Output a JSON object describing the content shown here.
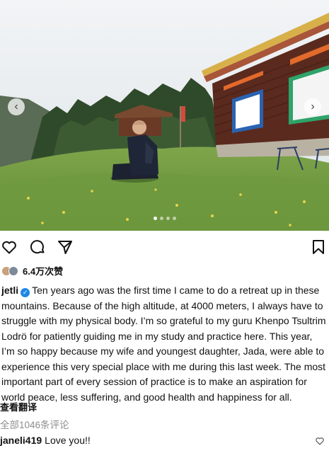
{
  "post": {
    "photo_alt": "",
    "carousel": {
      "prev_icon": "chevron-left-icon",
      "next_icon": "chevron-right-icon",
      "dot_count": 4,
      "active_dot": 0
    }
  },
  "actions": {
    "like_icon": "heart-icon",
    "comment_icon": "comment-icon",
    "share_icon": "send-icon",
    "save_icon": "bookmark-icon"
  },
  "likes": {
    "count_text": "6.4万次赞"
  },
  "caption": {
    "username": "jetli",
    "text": "Ten years ago was the first time I came to do a retreat up in these mountains. Because of the high altitude, at 4000 meters, I always have to struggle with my physical body. I’m so grateful to my guru Khenpo Tsultrim Lodrö for patiently guiding me in my study and practice here. This year, I’m so happy because my wife and youngest daughter, Jada, were able to experience this very special place with me during this last week. The most important part of every session of practice is to make an aspiration for world peace, less suffering, and good health and happiness for all."
  },
  "translate_label": "查看翻译",
  "all_comments_label": "全部1046条评论",
  "comment": {
    "username": "janeli419",
    "text": "Love you!!"
  },
  "colors": {
    "verified": "#1e88e5",
    "muted": "#8e8e8e"
  }
}
